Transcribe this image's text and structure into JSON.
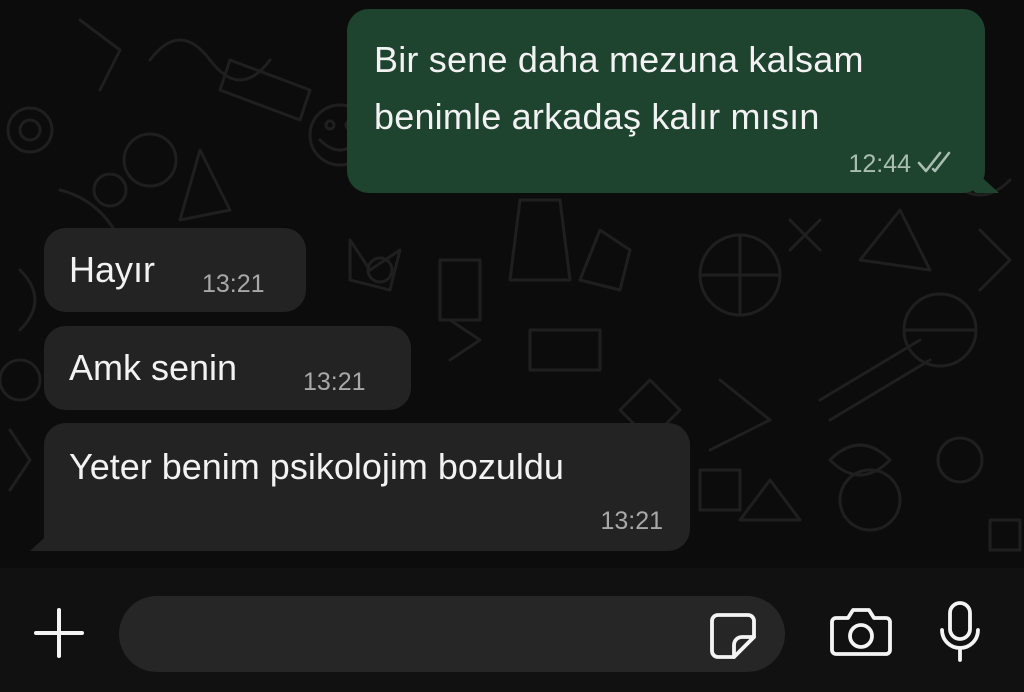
{
  "messages": {
    "outgoing": [
      {
        "text": "Bir sene daha mezuna kalsam\nbenimle arkadaş kalır mısın",
        "time": "12:44",
        "status_icon": "double-check-icon"
      }
    ],
    "incoming": [
      {
        "text": "Hayır",
        "time": "13:21"
      },
      {
        "text": "Amk senin",
        "time": "13:21"
      },
      {
        "text": "Yeter benim psikolojim bozuldu",
        "time": "13:21"
      }
    ]
  },
  "composer": {
    "input_value": "",
    "input_placeholder": "",
    "icons": {
      "attach": "plus-icon",
      "sticker": "sticker-icon",
      "camera": "camera-icon",
      "voice": "microphone-icon"
    }
  },
  "colors": {
    "chat_background": "#0c0c0c",
    "outgoing_bubble": "#1e4430",
    "incoming_bubble": "#232323",
    "composer_background": "#111111",
    "input_background": "#262626"
  }
}
